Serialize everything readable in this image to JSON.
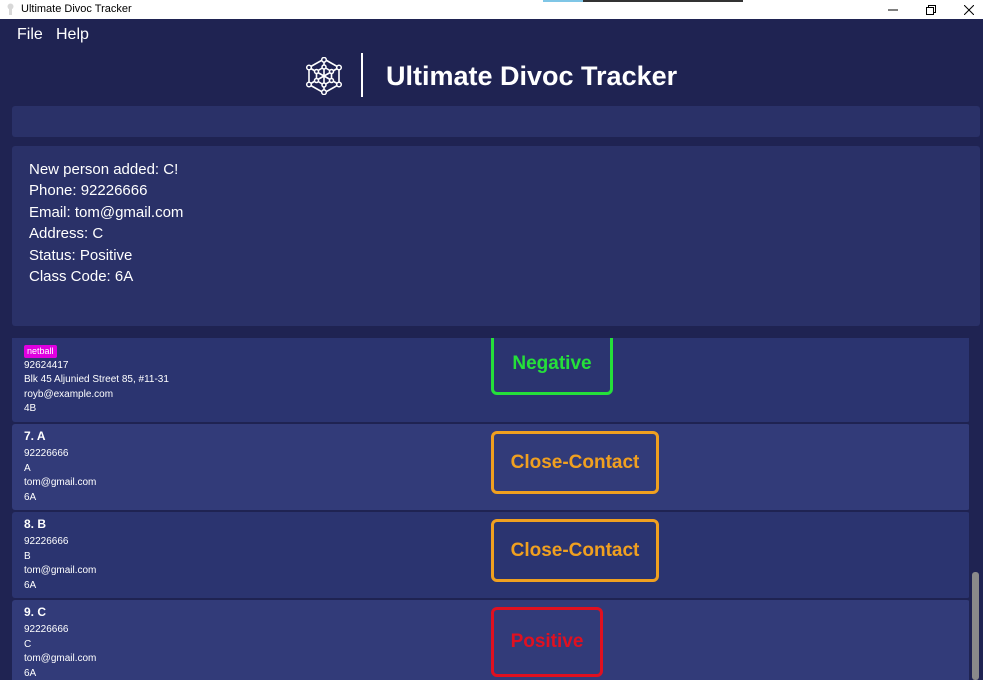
{
  "window": {
    "title": "Ultimate Divoc Tracker",
    "controls": {
      "minimize": "minimize-icon",
      "restore": "restore-icon",
      "close": "close-icon"
    }
  },
  "menu": {
    "file": "File",
    "help": "Help"
  },
  "header": {
    "title": "Ultimate Divoc Tracker",
    "logo_icon": "network-node-icon"
  },
  "command_box": {
    "value": ""
  },
  "result": {
    "lines": [
      "New person added: C!",
      "Phone: 92226666",
      "Email: tom@gmail.com",
      "Address: C",
      "Status: Positive",
      "Class Code: 6A"
    ]
  },
  "persons": [
    {
      "name": "",
      "tags": [
        "netball"
      ],
      "phone": "92624417",
      "address": "Blk 45 Aljunied Street 85, #11-31",
      "email": "royb@example.com",
      "class_code": "4B",
      "status": "Negative"
    },
    {
      "name": "7.  A",
      "tags": [],
      "phone": "92226666",
      "address": "A",
      "email": "tom@gmail.com",
      "class_code": "6A",
      "status": "Close-Contact"
    },
    {
      "name": "8.  B",
      "tags": [],
      "phone": "92226666",
      "address": "B",
      "email": "tom@gmail.com",
      "class_code": "6A",
      "status": "Close-Contact"
    },
    {
      "name": "9.  C",
      "tags": [],
      "phone": "92226666",
      "address": "C",
      "email": "tom@gmail.com",
      "class_code": "6A",
      "status": "Positive"
    }
  ],
  "colors": {
    "background": "#1f2352",
    "panel": "#2a3168",
    "negative": "#25e03a",
    "close_contact": "#f0a020",
    "positive": "#e01020",
    "tag": "#e000e0"
  }
}
